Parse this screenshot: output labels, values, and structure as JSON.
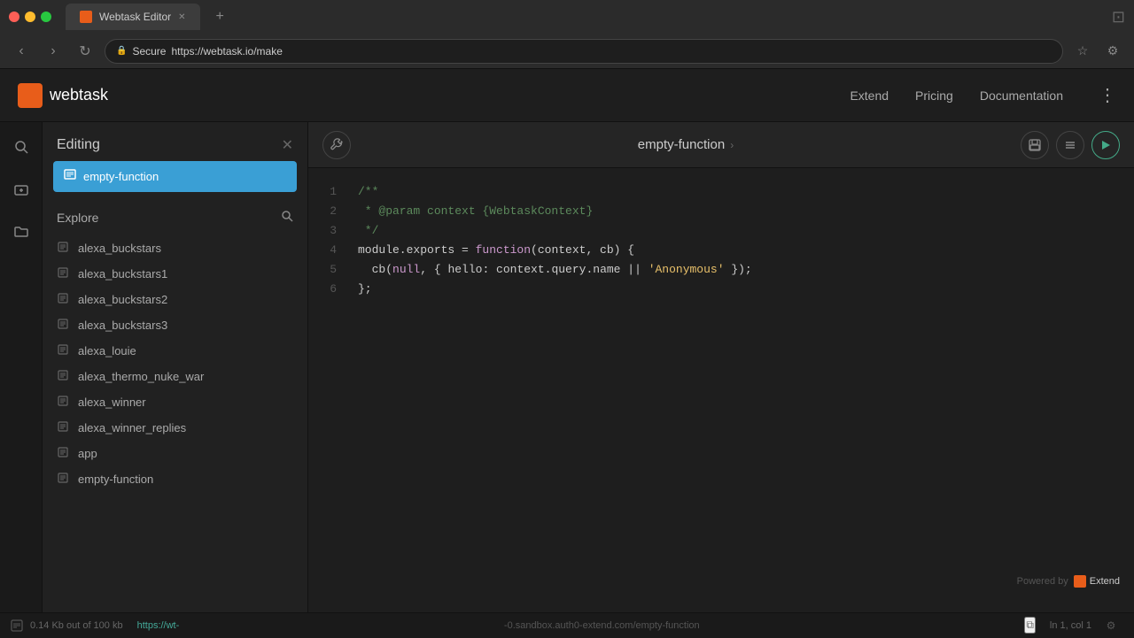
{
  "titlebar": {
    "tab_title": "Webtask Editor",
    "tab_new": "+",
    "traffic": [
      "red",
      "yellow",
      "green"
    ]
  },
  "browser": {
    "back": "‹",
    "forward": "›",
    "refresh": "↻",
    "secure_label": "Secure",
    "url": "https://webtask.io/make",
    "bookmark_icon": "☆",
    "settings_icon": "⚙"
  },
  "navbar": {
    "logo_text": "webtask",
    "links": [
      "Extend",
      "Pricing",
      "Documentation"
    ],
    "more_icon": "⋮"
  },
  "sidebar": {
    "title": "Editing",
    "close_icon": "✕",
    "active_task": "empty-function",
    "explore_title": "Explore",
    "explore_search_icon": "🔍",
    "items": [
      {
        "name": "alexa_buckstars"
      },
      {
        "name": "alexa_buckstars1"
      },
      {
        "name": "alexa_buckstars2"
      },
      {
        "name": "alexa_buckstars3"
      },
      {
        "name": "alexa_louie"
      },
      {
        "name": "alexa_thermo_nuke_war"
      },
      {
        "name": "alexa_winner"
      },
      {
        "name": "alexa_winner_replies"
      },
      {
        "name": "app"
      },
      {
        "name": "empty-function"
      }
    ]
  },
  "sidebar_icons": {
    "search": "🔍",
    "add": "+",
    "folder": "📁"
  },
  "editor": {
    "wrench_icon": "🔧",
    "title": "empty-function",
    "chevron": "›",
    "save_icon": "💾",
    "list_icon": "☰",
    "run_icon": "▶",
    "code_lines": [
      {
        "num": 1,
        "tokens": [
          {
            "type": "comment",
            "text": "/**"
          }
        ]
      },
      {
        "num": 2,
        "tokens": [
          {
            "type": "comment",
            "text": " * @param context {WebtaskContext}"
          }
        ]
      },
      {
        "num": 3,
        "tokens": [
          {
            "type": "comment",
            "text": " */"
          }
        ]
      },
      {
        "num": 4,
        "tokens": [
          {
            "type": "normal",
            "text": "module.exports = "
          },
          {
            "type": "keyword",
            "text": "function"
          },
          {
            "type": "normal",
            "text": "(context, cb) {"
          }
        ]
      },
      {
        "num": 5,
        "tokens": [
          {
            "type": "normal",
            "text": "  cb("
          },
          {
            "type": "keyword",
            "text": "null"
          },
          {
            "type": "normal",
            "text": ", { hello: context.query.name || "
          },
          {
            "type": "string",
            "text": "'Anonymous'"
          },
          {
            "type": "normal",
            "text": " });"
          }
        ]
      },
      {
        "num": 6,
        "tokens": [
          {
            "type": "normal",
            "text": "};"
          }
        ]
      }
    ]
  },
  "status_bar": {
    "file_size": "0.14 Kb out of 100 kb",
    "url_short": "https://wt-",
    "url_full": "-0.sandbox.auth0-extend.com/empty-function",
    "position": "ln 1, col 1",
    "copy_icon": "⧉",
    "settings_icon": "⚙",
    "powered_by": "Powered by",
    "extend_label": "Extend"
  }
}
